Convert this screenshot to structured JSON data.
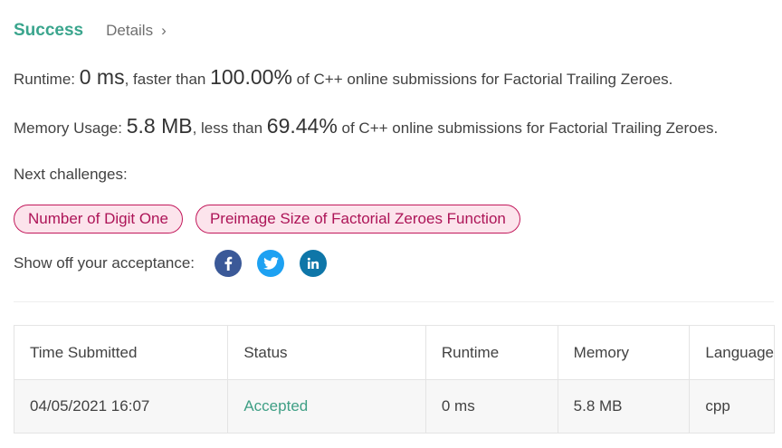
{
  "header": {
    "status": "Success",
    "details_label": "Details",
    "details_chevron": "›"
  },
  "runtime": {
    "label": "Runtime: ",
    "value": "0 ms",
    "comparison": ", faster than ",
    "percent": "100.00%",
    "suffix": " of C++ online submissions for Factorial Trailing Zeroes."
  },
  "memory": {
    "label": "Memory Usage: ",
    "value": "5.8 MB",
    "comparison": ", less than ",
    "percent": "69.44%",
    "suffix": " of C++ online submissions for Factorial Trailing Zeroes."
  },
  "next_challenges": {
    "label": "Next challenges:",
    "items": [
      {
        "label": "Number of Digit One"
      },
      {
        "label": "Preimage Size of Factorial Zeroes Function"
      }
    ]
  },
  "share": {
    "label": "Show off your acceptance:",
    "icons": [
      "facebook-icon",
      "twitter-icon",
      "linkedin-icon"
    ]
  },
  "colors": {
    "success": "#3aa58d",
    "pill_border": "#c2185b",
    "pill_bg": "#fce4ec",
    "facebook": "#3b5998",
    "twitter": "#1da1f2",
    "linkedin": "#0e76a8"
  },
  "submissions": {
    "columns": [
      "Time Submitted",
      "Status",
      "Runtime",
      "Memory",
      "Language"
    ],
    "rows": [
      {
        "time": "04/05/2021 16:07",
        "status": "Accepted",
        "runtime": "0 ms",
        "memory": "5.8 MB",
        "language": "cpp"
      }
    ]
  }
}
